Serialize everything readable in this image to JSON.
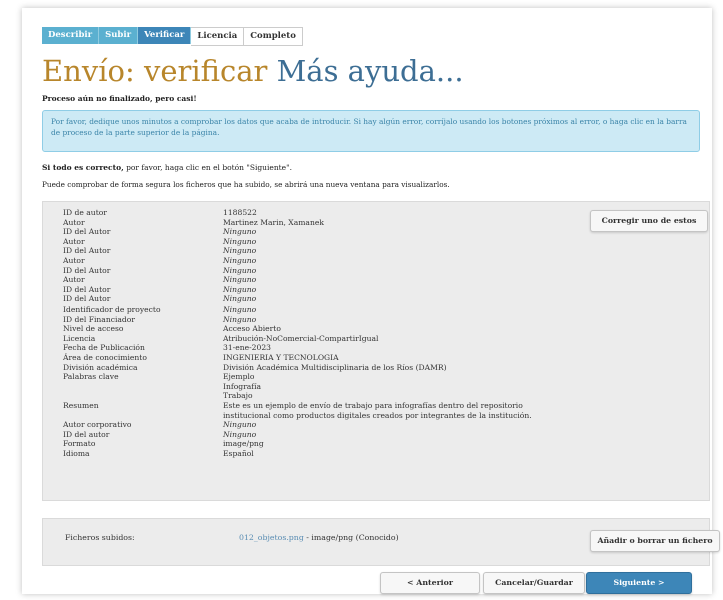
{
  "tabs": [
    {
      "label": "Describir",
      "state": "done"
    },
    {
      "label": "Subir",
      "state": "done"
    },
    {
      "label": "Verificar",
      "state": "active"
    },
    {
      "label": "Licencia",
      "state": "todo"
    },
    {
      "label": "Completo",
      "state": "todo"
    }
  ],
  "page": {
    "title": "Envío: verificar",
    "help": "Más ayuda...",
    "subline": "Proceso aún no finalizado, pero casi!",
    "info": "Por favor, dedique unos minutos a comprobar los datos que acaba de introducir. Si hay algún error, corríjalo usando los botones próximos al error, o haga clic en la barra de proceso de la parte superior de la página.",
    "para1_bold": "Si todo es correcto,",
    "para1_rest": " por favor, haga clic en el botón \"Siguiente\".",
    "para2": "Puede comprobar de forma segura los ficheros que ha subido, se abrirá una nueva ventana para visualizarlos."
  },
  "metadata_clipped": [
    {
      "k": "ID de autor",
      "v": "1188522",
      "none": false
    },
    {
      "k": "Autor",
      "v": "Martinez Marin, Xamanek",
      "none": false
    },
    {
      "k": "ID del Autor",
      "v": "Ninguno",
      "none": true
    },
    {
      "k": "Autor",
      "v": "Ninguno",
      "none": true
    },
    {
      "k": "ID del Autor",
      "v": "Ninguno",
      "none": true
    },
    {
      "k": "Autor",
      "v": "Ninguno",
      "none": true
    },
    {
      "k": "ID del Autor",
      "v": "Ninguno",
      "none": true
    },
    {
      "k": "Autor",
      "v": "Ninguno",
      "none": true
    },
    {
      "k": "ID del Autor",
      "v": "Ninguno",
      "none": true
    },
    {
      "k": "ID del Autor",
      "v": "Ninguno",
      "none": true
    }
  ],
  "metadata": [
    {
      "k": "Identificador de proyecto",
      "v": "Ninguno",
      "none": true
    },
    {
      "k": "ID del Financiador",
      "v": "Ninguno",
      "none": true
    },
    {
      "k": "Nivel de acceso",
      "v": "Acceso Abierto",
      "none": false
    },
    {
      "k": "Licencia",
      "v": "Atribución-NoComercial-CompartirIgual",
      "none": false
    },
    {
      "k": "Fecha de Publicación",
      "v": "31-ene-2023",
      "none": false
    },
    {
      "k": "Área de conocimiento",
      "v": "INGENIERIA Y TECNOLOGIA",
      "none": false
    },
    {
      "k": "División académica",
      "v": "División Académica Multidisciplinaria de los Ríos (DAMR)",
      "none": false
    },
    {
      "k": "Palabras clave",
      "v": "Ejemplo",
      "none": false
    },
    {
      "k": "",
      "v": "Infografía",
      "none": false
    },
    {
      "k": "",
      "v": "Trabajo",
      "none": false
    },
    {
      "k": "Resumen",
      "v": "Este es un ejemplo de envío de trabajo para infografías dentro del repositorio",
      "none": false
    },
    {
      "k": "",
      "v": "institucional como productos digitales creados por integrantes de la institución.",
      "none": false
    },
    {
      "k": "Autor corporativo",
      "v": "Ninguno",
      "none": true
    },
    {
      "k": "ID del autor",
      "v": "Ninguno",
      "none": true
    },
    {
      "k": "Formato",
      "v": "image/png",
      "none": false
    },
    {
      "k": "Idioma",
      "v": "Español",
      "none": false
    }
  ],
  "buttons": {
    "correct": "Corregir uno de estos",
    "files": "Añadir o borrar un fichero",
    "previous": "< Anterior",
    "cancel": "Cancelar/Guardar",
    "next": "Siguiente >"
  },
  "files": {
    "label": "Ficheros subidos:",
    "file_link": "012_objetos.png",
    "file_info": " - image/png (Conocido)"
  },
  "colors": {
    "tab_done": "#5bb0d0",
    "tab_active": "#3d86b8",
    "title": "#b8862b",
    "help": "#3d6e94"
  }
}
